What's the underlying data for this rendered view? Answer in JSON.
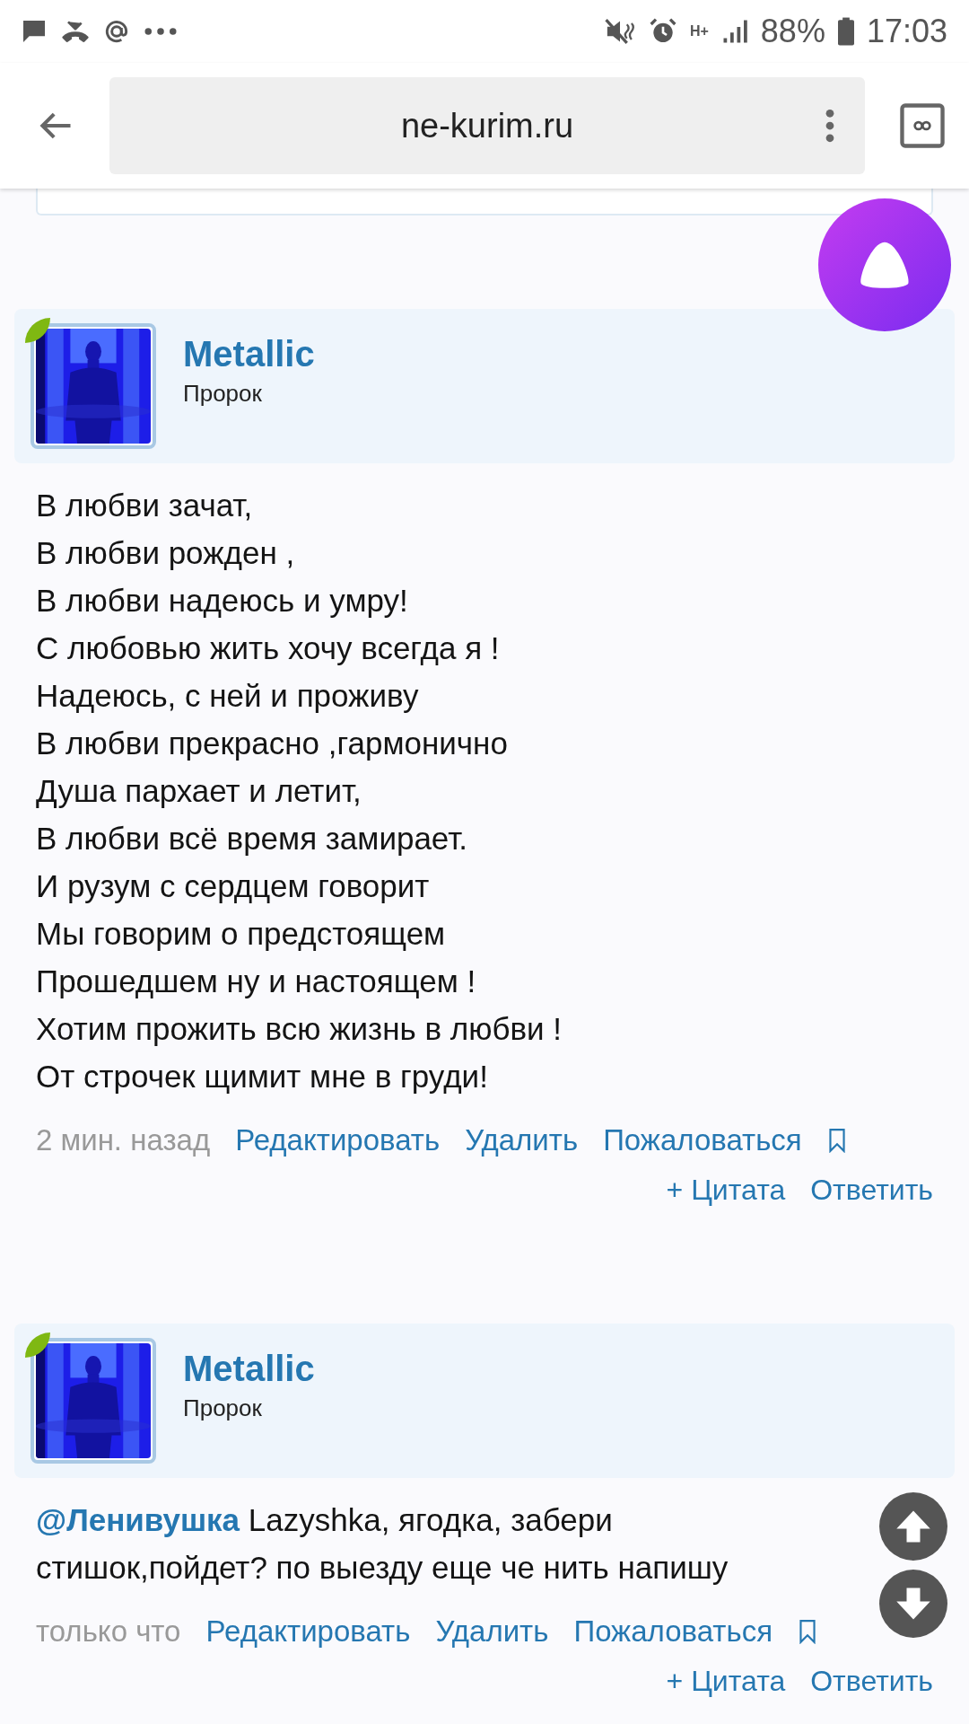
{
  "status_bar": {
    "network": "H+",
    "battery": "88%",
    "time": "17:03"
  },
  "browser": {
    "url": "ne-kurim.ru"
  },
  "posts": [
    {
      "author": "Metallic",
      "rank": "Пророк",
      "online": true,
      "avatar": {
        "kind": "picture"
      },
      "lines": [
        "В любви зачат,",
        "В любви рожден ,",
        "В любви надеюсь и умру!",
        "С любовью жить хочу всегда я !",
        "Надеюсь, с ней и проживу",
        "В любви прекрасно ,гармонично",
        "Душа пархает и летит,",
        "В любви всё время замирает.",
        "И рузум с сердцем говорит",
        "Мы говорим о предстоящем",
        "Прошедшем ну и настоящем !",
        "Хотим прожить всю жизнь в любви !",
        "От строчек щимит мне в груди!"
      ],
      "time": "2 мин. назад",
      "actions": [
        "Редактировать",
        "Удалить",
        "Пожаловаться"
      ],
      "replies": [
        "+ Цитата",
        "Ответить"
      ]
    },
    {
      "author": "Metallic",
      "rank": "Пророк",
      "online": true,
      "avatar": {
        "kind": "picture"
      },
      "mention": "@Ленивушка",
      "text": "Lazyshka, ягодка, забери стишок,пойдет? по выезду еще че нить напишу",
      "time": "только что",
      "actions": [
        "Редактировать",
        "Удалить",
        "Пожаловаться"
      ],
      "replies": [
        "+ Цитата",
        "Ответить"
      ]
    }
  ]
}
